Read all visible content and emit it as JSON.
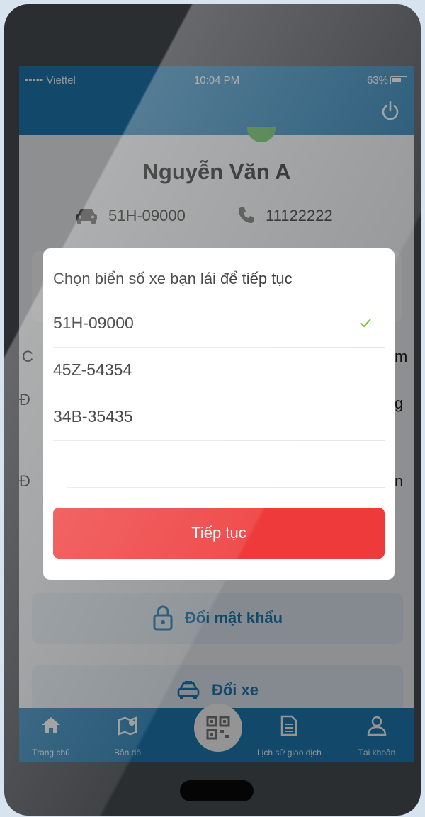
{
  "status_bar": {
    "carrier": "••••• Viettel",
    "time": "10:04 PM",
    "battery": "63%"
  },
  "profile": {
    "name": "Nguyễn Văn A",
    "plate": "51H-09000",
    "phone": "11122222"
  },
  "background_fragments": {
    "left_1": "C",
    "right_1": "m",
    "left_2": "Đ",
    "right_2": "g",
    "left_3": "Đ",
    "right_3": "n"
  },
  "actions": {
    "change_password": "Đổi mật khẩu",
    "change_vehicle": "Đổi xe"
  },
  "tabs": [
    {
      "label": "Trang chủ",
      "icon": "home-icon"
    },
    {
      "label": "Bản đồ",
      "icon": "map-icon"
    },
    {
      "label": "",
      "icon": "qr-scan-icon"
    },
    {
      "label": "Lịch sử giao dịch",
      "icon": "history-icon"
    },
    {
      "label": "Tài khoản",
      "icon": "account-icon"
    }
  ],
  "modal": {
    "title": "Chọn biển số xe bạn lái để tiếp tục",
    "plates": [
      {
        "plate": "51H-09000",
        "selected": true
      },
      {
        "plate": "45Z-54354",
        "selected": false
      },
      {
        "plate": "34B-35435",
        "selected": false
      },
      {
        "plate": "",
        "selected": false
      }
    ],
    "continue_label": "Tiếp tục"
  },
  "colors": {
    "primary": "#1f7fb9",
    "accent": "#ee3a3a",
    "check": "#7cbf3f"
  }
}
